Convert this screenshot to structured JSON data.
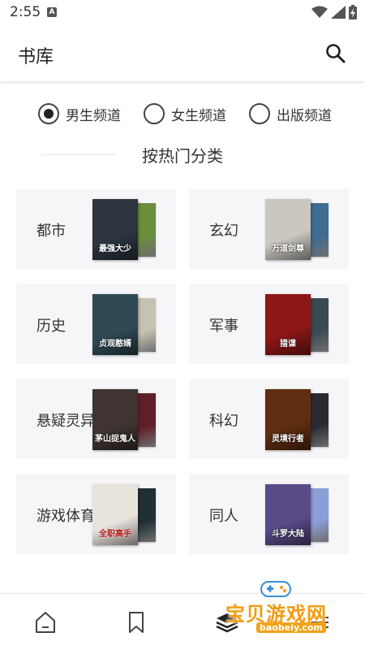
{
  "status_bar": {
    "time": "2:55",
    "notification_icon": "A"
  },
  "app_bar": {
    "title": "书库",
    "search_icon": "search-icon"
  },
  "channels": [
    {
      "label": "男生频道",
      "selected": true
    },
    {
      "label": "女生频道",
      "selected": false
    },
    {
      "label": "出版频道",
      "selected": false
    }
  ],
  "section_title": "按热门分类",
  "categories": [
    {
      "label": "都市",
      "front_color": "#2c3540",
      "back_color": "#6a8e3a",
      "front_text": "最强大少"
    },
    {
      "label": "玄幻",
      "front_color": "#cbc7c0",
      "back_color": "#3f6c91",
      "front_text": "万道剑尊"
    },
    {
      "label": "历史",
      "front_color": "#2f4a55",
      "back_color": "#c7c1b1",
      "front_text": "贞观憨婿"
    },
    {
      "label": "军事",
      "front_color": "#8d1717",
      "back_color": "#3a4a52",
      "front_text": "猎谍"
    },
    {
      "label": "悬疑灵异",
      "front_color": "#3f3431",
      "back_color": "#601f28",
      "front_text": "茅山捉鬼人"
    },
    {
      "label": "科幻",
      "front_color": "#5f2d10",
      "back_color": "#2a2a33",
      "front_text": "灵境行者"
    },
    {
      "label": "游戏体育",
      "front_color": "#e9e3dd",
      "back_color": "#1f2f33",
      "front_text": "全职高手"
    },
    {
      "label": "同人",
      "front_color": "#5a4a88",
      "back_color": "#8a9ed8",
      "front_text": "斗罗大陆"
    }
  ],
  "bottom_nav": [
    {
      "name": "home-icon"
    },
    {
      "name": "bookmark-icon"
    },
    {
      "name": "library-stack-icon"
    },
    {
      "name": "menu-icon"
    }
  ],
  "watermark": {
    "text": "宝贝游戏网",
    "url": "baobeiy.com"
  },
  "colors": {
    "accent": "#222222",
    "card_bg": "#f6f6f8",
    "watermark": "#f29b11"
  }
}
